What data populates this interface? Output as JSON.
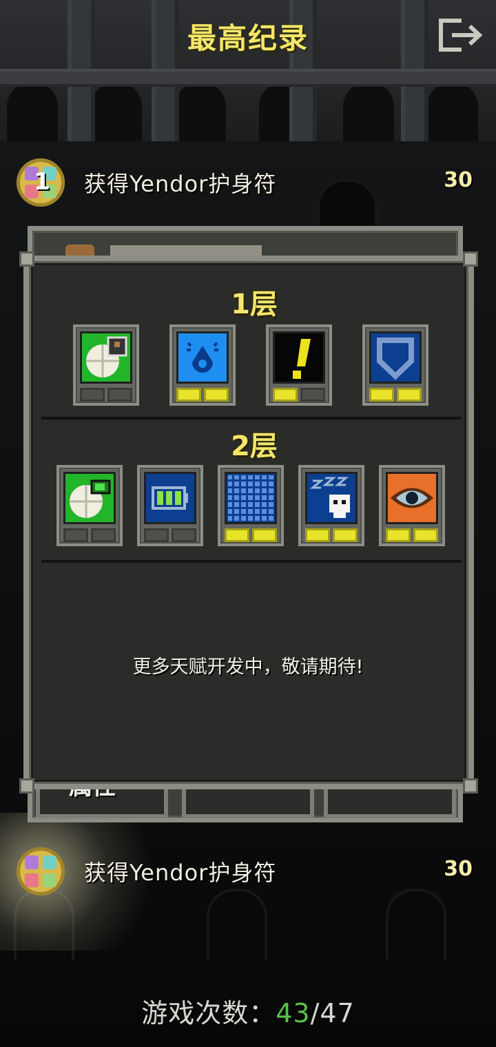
{
  "header": {
    "title": "最高纪录"
  },
  "records": [
    {
      "rank": "1",
      "text": "获得Yendor护身符",
      "depth": "30"
    },
    {
      "rank": "",
      "text": "获得Yendor护身符",
      "depth": "30"
    }
  ],
  "back_panel": {
    "tab_label": "属性"
  },
  "talents_window": {
    "tiers": [
      {
        "title": "1层",
        "talents": [
          {
            "icon": "ration-icon",
            "points": 0,
            "max": 2
          },
          {
            "icon": "water-drop-icon",
            "points": 2,
            "max": 2
          },
          {
            "icon": "alert-icon",
            "points": 1,
            "max": 2
          },
          {
            "icon": "shield-icon",
            "points": 2,
            "max": 2
          }
        ]
      },
      {
        "title": "2层",
        "talents": [
          {
            "icon": "ration-battery-icon",
            "points": 0,
            "max": 2
          },
          {
            "icon": "battery-icon",
            "points": 0,
            "max": 2
          },
          {
            "icon": "grid-icon",
            "points": 2,
            "max": 2
          },
          {
            "icon": "sleep-skull-icon",
            "points": 2,
            "max": 2
          },
          {
            "icon": "eye-icon",
            "points": 2,
            "max": 2
          }
        ]
      }
    ],
    "info_text": "更多天赋开发中，敬请期待!"
  },
  "footer": {
    "games_label": "游戏次数：",
    "games_won": "43",
    "games_separator": "/",
    "games_total": "47"
  },
  "colors": {
    "title_yellow": "#f4e66a",
    "pip_on": "#e9e42a",
    "won_green": "#58c24a",
    "frame": "#8c8e85"
  }
}
